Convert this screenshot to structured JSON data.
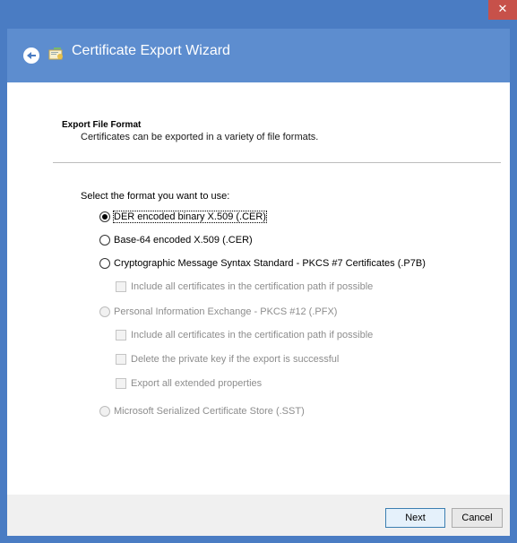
{
  "window": {
    "close_glyph": "✕"
  },
  "header": {
    "title": "Certificate Export Wizard",
    "back_icon": "back-arrow-icon",
    "cert_icon": "certificate-icon"
  },
  "section": {
    "title": "Export File Format",
    "subtitle": "Certificates can be exported in a variety of file formats."
  },
  "prompt": "Select the format you want to use:",
  "options": [
    {
      "label": "DER encoded binary X.509 (.CER)",
      "type": "radio",
      "checked": true,
      "enabled": true
    },
    {
      "label": "Base-64 encoded X.509 (.CER)",
      "type": "radio",
      "checked": false,
      "enabled": true
    },
    {
      "label": "Cryptographic Message Syntax Standard - PKCS #7 Certificates (.P7B)",
      "type": "radio",
      "checked": false,
      "enabled": true
    },
    {
      "label": "Include all certificates in the certification path if possible",
      "type": "checkbox",
      "checked": false,
      "enabled": false
    },
    {
      "label": "Personal Information Exchange - PKCS #12 (.PFX)",
      "type": "radio",
      "checked": false,
      "enabled": false
    },
    {
      "label": "Include all certificates in the certification path if possible",
      "type": "checkbox",
      "checked": false,
      "enabled": false
    },
    {
      "label": "Delete the private key if the export is successful",
      "type": "checkbox",
      "checked": false,
      "enabled": false
    },
    {
      "label": "Export all extended properties",
      "type": "checkbox",
      "checked": false,
      "enabled": false
    },
    {
      "label": "Microsoft Serialized Certificate Store (.SST)",
      "type": "radio",
      "checked": false,
      "enabled": false
    }
  ],
  "footer": {
    "next_label": "Next",
    "cancel_label": "Cancel"
  },
  "colors": {
    "title_bar": "#4a7cc3",
    "header": "#5d8dcf",
    "close": "#c7514a"
  }
}
